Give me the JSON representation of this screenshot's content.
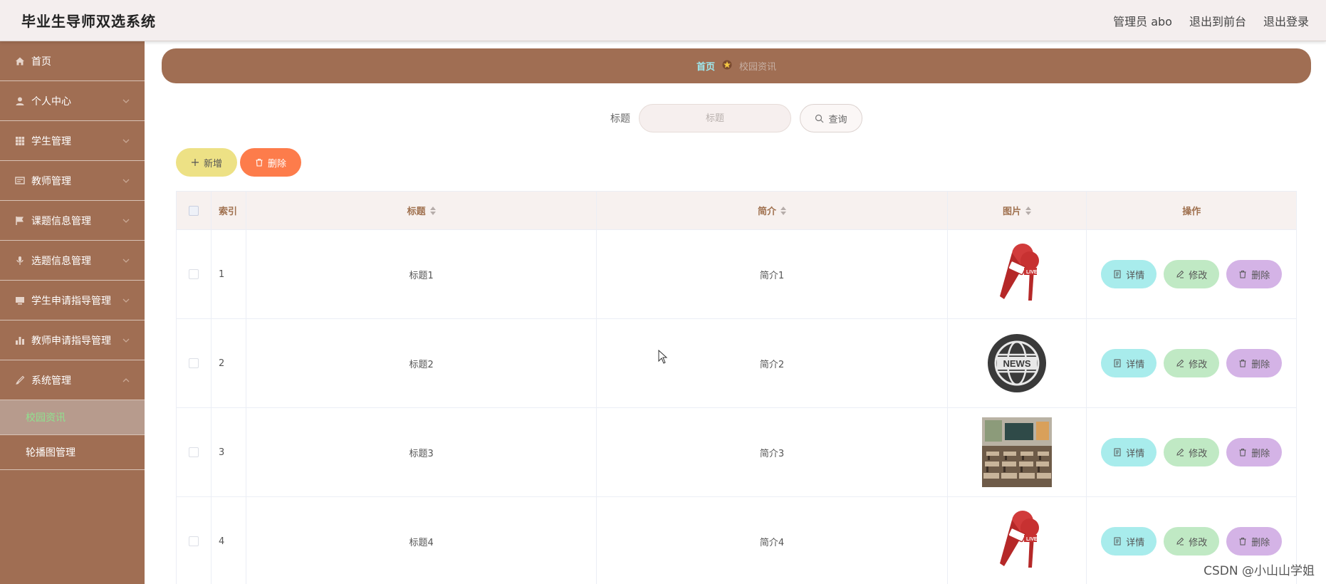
{
  "header": {
    "app_title": "毕业生导师双选系统",
    "user": "管理员 abo",
    "frontend_link": "退出到前台",
    "logout_link": "退出登录"
  },
  "sidebar": {
    "items": [
      {
        "label": "首页",
        "icon": "home-icon",
        "has_chevron": false
      },
      {
        "label": "个人中心",
        "icon": "user-icon",
        "has_chevron": true
      },
      {
        "label": "学生管理",
        "icon": "grid-icon",
        "has_chevron": true
      },
      {
        "label": "教师管理",
        "icon": "message-icon",
        "has_chevron": true
      },
      {
        "label": "课题信息管理",
        "icon": "flag-icon",
        "has_chevron": true
      },
      {
        "label": "选题信息管理",
        "icon": "microphone-icon",
        "has_chevron": true
      },
      {
        "label": "学生申请指导管理",
        "icon": "monitor-icon",
        "has_chevron": true
      },
      {
        "label": "教师申请指导管理",
        "icon": "bar-chart-icon",
        "has_chevron": true
      },
      {
        "label": "系统管理",
        "icon": "brush-icon",
        "has_chevron": true,
        "expanded": true
      }
    ],
    "subitems": [
      {
        "label": "校园资讯",
        "active": true
      },
      {
        "label": "轮播图管理",
        "active": false
      }
    ]
  },
  "breadcrumb": {
    "home": "首页",
    "current": "校园资讯"
  },
  "search": {
    "label": "标题",
    "placeholder": "标题",
    "query_label": "查询"
  },
  "actions": {
    "add_label": "新增",
    "delete_label": "删除"
  },
  "table": {
    "headers": {
      "index": "索引",
      "title": "标题",
      "intro": "简介",
      "image": "图片",
      "ops": "操作"
    },
    "rows": [
      {
        "index": "1",
        "title": "标题1",
        "intro": "简介1",
        "image": "live-microphone-image"
      },
      {
        "index": "2",
        "title": "标题2",
        "intro": "简介2",
        "image": "news-globe-image"
      },
      {
        "index": "3",
        "title": "标题3",
        "intro": "简介3",
        "image": "classroom-photo"
      },
      {
        "index": "4",
        "title": "标题4",
        "intro": "简介4",
        "image": "live-microphone-image"
      }
    ],
    "op_labels": {
      "detail": "详情",
      "edit": "修改",
      "delete": "删除"
    }
  },
  "watermark": "CSDN @小山山学姐",
  "colors": {
    "sidebar": "#a06e53",
    "breadcrumb_home": "#9ee9ef",
    "active_submenu_text": "#8fe28f",
    "add_button": "#ede185",
    "delete_button": "#fd7c4b",
    "detail_button": "#a8ecec",
    "edit_button": "#c0e9c4",
    "row_delete_button": "#d4b3e6"
  }
}
